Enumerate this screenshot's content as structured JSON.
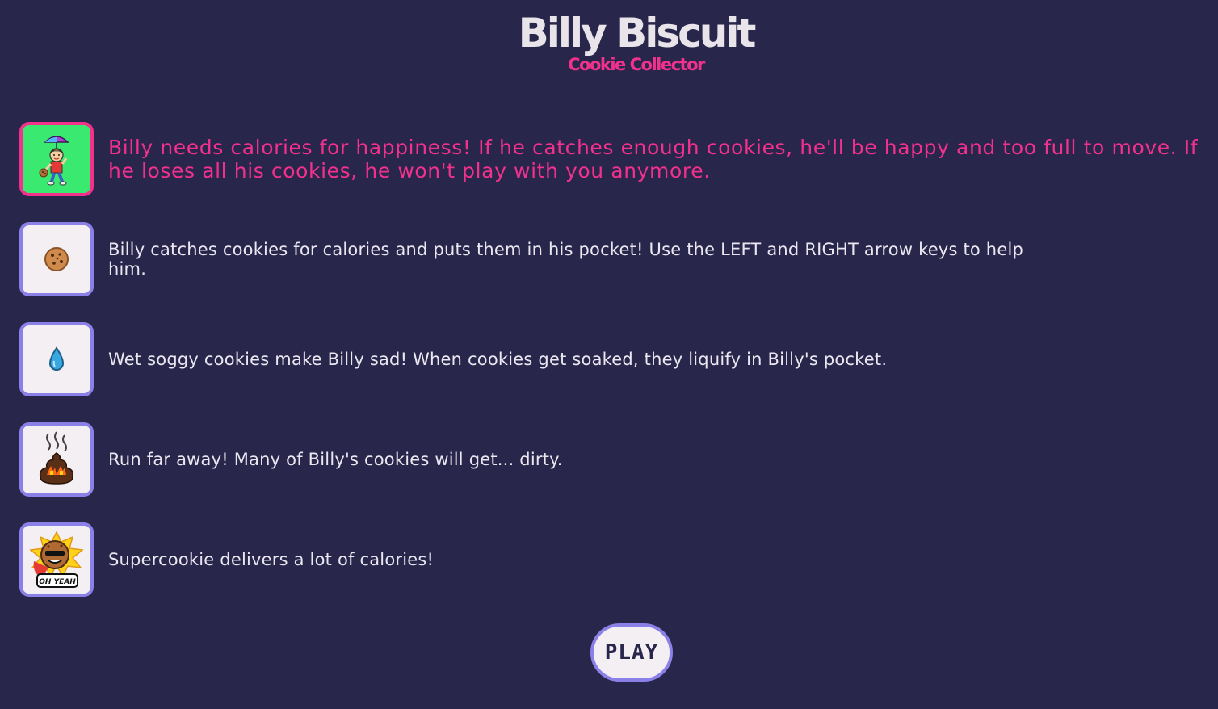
{
  "header": {
    "title": "Billy Biscuit",
    "subtitle": "Cookie Collector"
  },
  "instructions": [
    {
      "icon": "billy-with-umbrella-icon",
      "text": "Billy needs calories for happiness! If he catches enough cookies, he'll be happy and too full to move. If he loses all his cookies, he won't play with you anymore."
    },
    {
      "icon": "cookie-icon",
      "text": "Billy catches cookies for calories and puts them in his pocket! Use the LEFT and RIGHT arrow keys to help him."
    },
    {
      "icon": "water-drop-icon",
      "text": "Wet soggy cookies make Billy sad! When cookies get soaked, they liquify in Billy's pocket."
    },
    {
      "icon": "stinky-poop-icon",
      "text": "Run far away! Many of Billy's cookies will get... dirty."
    },
    {
      "icon": "supercookie-icon",
      "text": "Supercookie delivers a lot of calories!",
      "badge": "OH YEAH"
    }
  ],
  "play_button": {
    "label": "PLAY"
  },
  "colors": {
    "background": "#29264c",
    "accent_pink": "#f2318d",
    "tile_border": "#8a80e8",
    "hero_tile_bg": "#3ae96f",
    "text": "#ebe7f0"
  }
}
